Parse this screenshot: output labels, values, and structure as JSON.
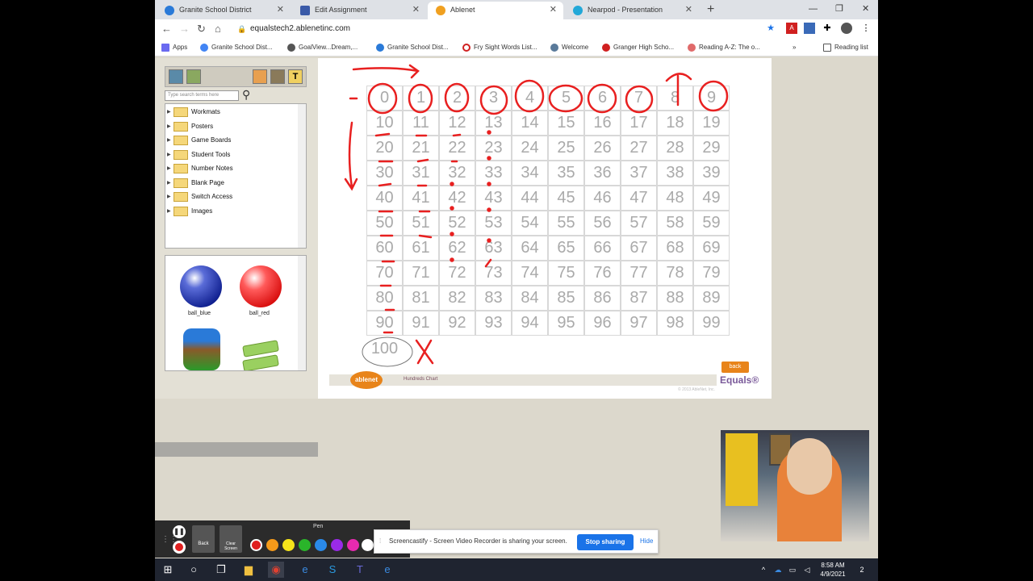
{
  "browser": {
    "tabs": [
      {
        "title": "Granite School District",
        "active": false
      },
      {
        "title": "Edit Assignment",
        "active": false
      },
      {
        "title": "Ablenet",
        "active": true
      },
      {
        "title": "Nearpod - Presentation",
        "active": false
      }
    ],
    "url": "equalstech2.ablenetinc.com",
    "bookmarks": [
      "Apps",
      "Granite School Dist...",
      "GoalView...Dream,...",
      "Granite School Dist...",
      "Fry Sight Words List...",
      "Welcome",
      "Granger High Scho...",
      "Reading A-Z: The o..."
    ],
    "reading_list": "Reading list",
    "overflow": "»"
  },
  "left_panel": {
    "search_placeholder": "Type search terms here",
    "folders": [
      "Workmats",
      "Posters",
      "Game Boards",
      "Student Tools",
      "Number Notes",
      "Blank Page",
      "Switch Access",
      "Images"
    ],
    "gallery": [
      {
        "label": "ball_blue"
      },
      {
        "label": "ball_red"
      }
    ]
  },
  "chart": {
    "numbers": [
      "0",
      "1",
      "2",
      "3",
      "4",
      "5",
      "6",
      "7",
      "8",
      "9",
      "10",
      "11",
      "12",
      "13",
      "14",
      "15",
      "16",
      "17",
      "18",
      "19",
      "20",
      "21",
      "22",
      "23",
      "24",
      "25",
      "26",
      "27",
      "28",
      "29",
      "30",
      "31",
      "32",
      "33",
      "34",
      "35",
      "36",
      "37",
      "38",
      "39",
      "40",
      "41",
      "42",
      "43",
      "44",
      "45",
      "46",
      "47",
      "48",
      "49",
      "50",
      "51",
      "52",
      "53",
      "54",
      "55",
      "56",
      "57",
      "58",
      "59",
      "60",
      "61",
      "62",
      "63",
      "64",
      "65",
      "66",
      "67",
      "68",
      "69",
      "70",
      "71",
      "72",
      "73",
      "74",
      "75",
      "76",
      "77",
      "78",
      "79",
      "80",
      "81",
      "82",
      "83",
      "84",
      "85",
      "86",
      "87",
      "88",
      "89",
      "90",
      "91",
      "92",
      "93",
      "94",
      "95",
      "96",
      "97",
      "98",
      "99"
    ],
    "hundred": "100",
    "footer_title": "Hundreds Chart",
    "logo": "ablenet",
    "back": "back",
    "brand": "Equals®",
    "copyright": "© 2013 AbleNet, Inc."
  },
  "screencastify": {
    "pen_label": "Pen",
    "back_label": "Back",
    "clear_label": "Clear Screen",
    "colors": [
      "#e02020",
      "#f59a1a",
      "#f5e41a",
      "#2ab52a",
      "#2a8ae8",
      "#9a2ae8",
      "#e82ab0",
      "#ffffff"
    ]
  },
  "share_bar": {
    "message": "Screencastify - Screen Video Recorder is sharing your screen.",
    "stop": "Stop sharing",
    "hide": "Hide"
  },
  "taskbar": {
    "time": "8:58 AM",
    "date": "4/9/2021",
    "notifications": "2"
  }
}
